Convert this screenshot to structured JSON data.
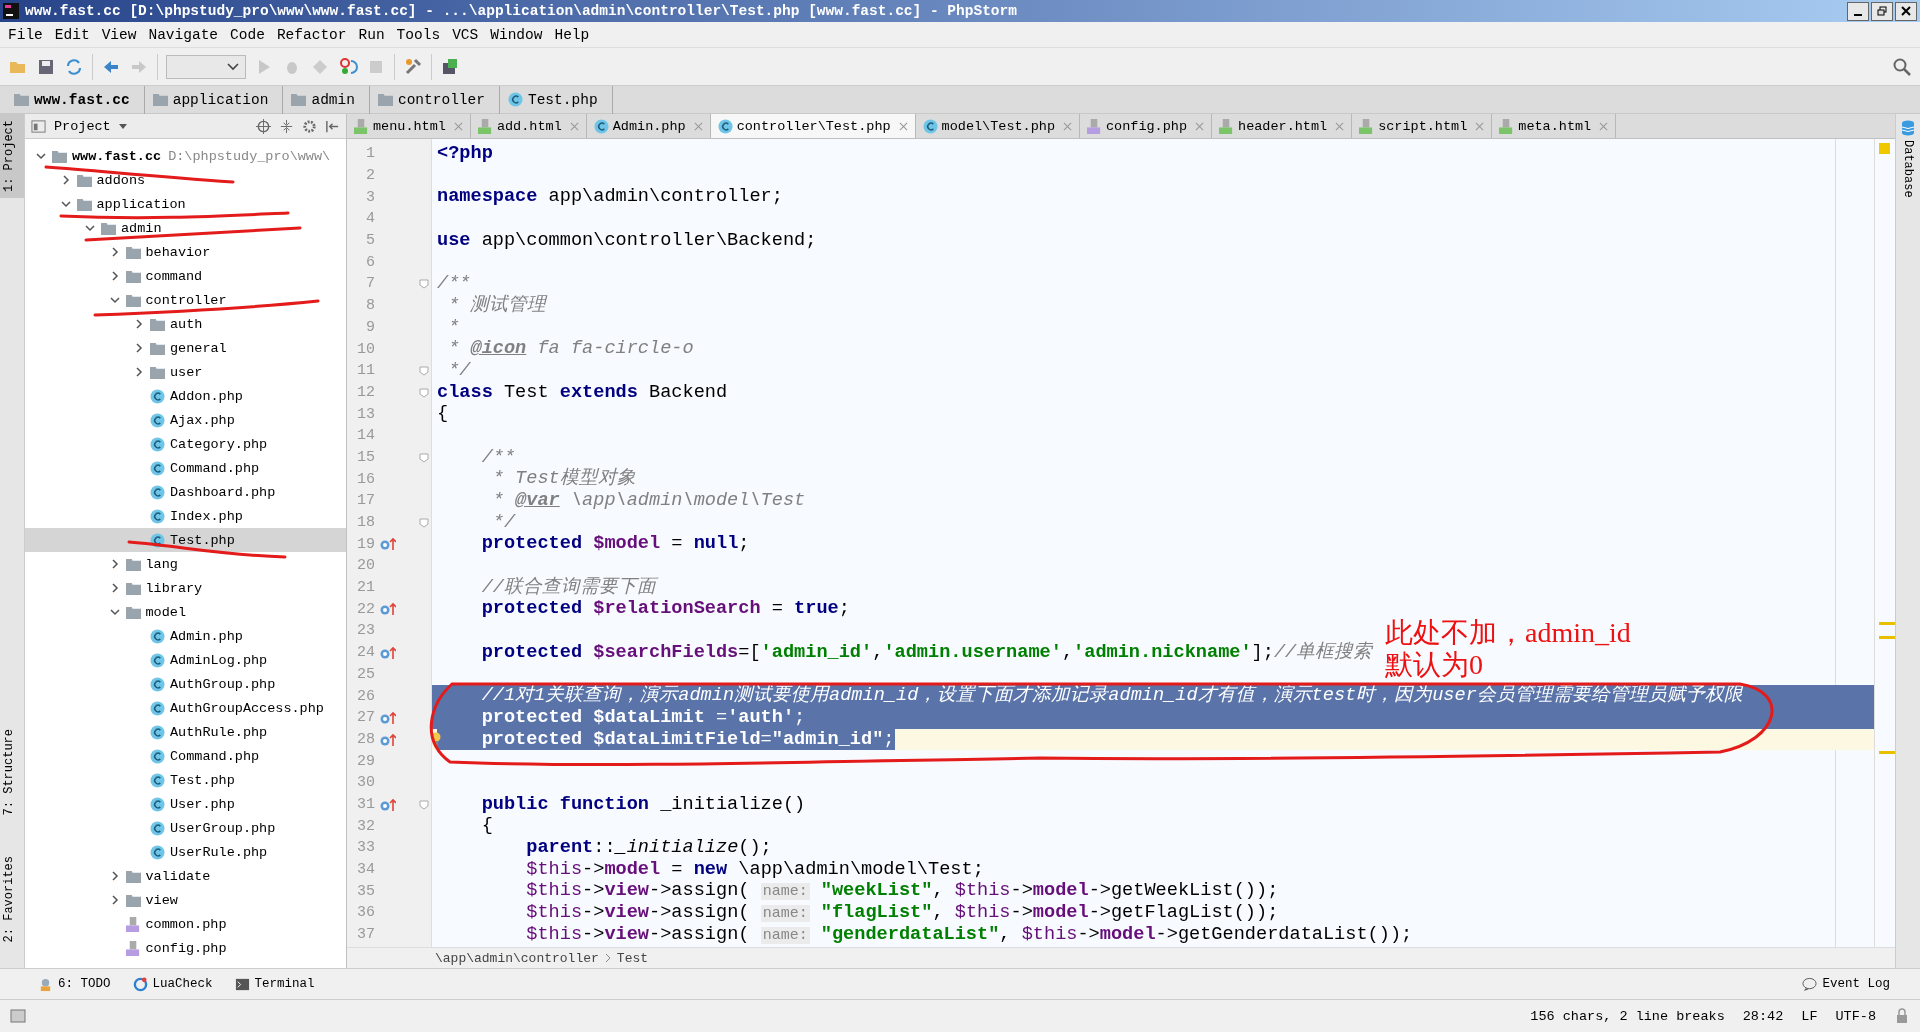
{
  "window": {
    "title": "www.fast.cc [D:\\phpstudy_pro\\www\\www.fast.cc] - ...\\application\\admin\\controller\\Test.php [www.fast.cc] - PhpStorm"
  },
  "menu": [
    "File",
    "Edit",
    "View",
    "Navigate",
    "Code",
    "Refactor",
    "Run",
    "Tools",
    "VCS",
    "Window",
    "Help"
  ],
  "nav_bar": [
    {
      "label": "www.fast.cc",
      "kind": "root"
    },
    {
      "label": "application",
      "kind": "folder"
    },
    {
      "label": "admin",
      "kind": "folder"
    },
    {
      "label": "controller",
      "kind": "folder"
    },
    {
      "label": "Test.php",
      "kind": "class"
    }
  ],
  "left_stripe": [
    {
      "label": "1: Project",
      "selected": true
    },
    {
      "label": "7: Structure",
      "selected": false
    },
    {
      "label": "2: Favorites",
      "selected": false
    }
  ],
  "right_stripe": [
    {
      "label": "Database"
    }
  ],
  "project": {
    "title": "Project",
    "tree": [
      {
        "label": "www.fast.cc",
        "path": "D:\\phpstudy_pro\\www\\",
        "kind": "root",
        "expanded": true,
        "selected": false,
        "children": [
          {
            "label": "addons",
            "kind": "folder",
            "expanded": false,
            "selected": false
          },
          {
            "label": "application",
            "kind": "folder",
            "expanded": true,
            "selected": false,
            "children": [
              {
                "label": "admin",
                "kind": "folder",
                "expanded": true,
                "selected": false,
                "children": [
                  {
                    "label": "behavior",
                    "kind": "folder",
                    "expanded": false,
                    "selected": false
                  },
                  {
                    "label": "command",
                    "kind": "folder",
                    "expanded": false,
                    "selected": false
                  },
                  {
                    "label": "controller",
                    "kind": "folder",
                    "expanded": true,
                    "selected": false,
                    "children": [
                      {
                        "label": "auth",
                        "kind": "folder",
                        "expanded": false,
                        "selected": false
                      },
                      {
                        "label": "general",
                        "kind": "folder",
                        "expanded": false,
                        "selected": false
                      },
                      {
                        "label": "user",
                        "kind": "folder",
                        "expanded": false,
                        "selected": false
                      },
                      {
                        "label": "Addon.php",
                        "kind": "class",
                        "selected": false
                      },
                      {
                        "label": "Ajax.php",
                        "kind": "class",
                        "selected": false
                      },
                      {
                        "label": "Category.php",
                        "kind": "class",
                        "selected": false
                      },
                      {
                        "label": "Command.php",
                        "kind": "class",
                        "selected": false
                      },
                      {
                        "label": "Dashboard.php",
                        "kind": "class",
                        "selected": false
                      },
                      {
                        "label": "Index.php",
                        "kind": "class",
                        "selected": false
                      },
                      {
                        "label": "Test.php",
                        "kind": "class",
                        "selected": true
                      }
                    ]
                  },
                  {
                    "label": "lang",
                    "kind": "folder",
                    "expanded": false,
                    "selected": false
                  },
                  {
                    "label": "library",
                    "kind": "folder",
                    "expanded": false,
                    "selected": false
                  },
                  {
                    "label": "model",
                    "kind": "folder",
                    "expanded": true,
                    "selected": false,
                    "children": [
                      {
                        "label": "Admin.php",
                        "kind": "class",
                        "selected": false
                      },
                      {
                        "label": "AdminLog.php",
                        "kind": "class",
                        "selected": false
                      },
                      {
                        "label": "AuthGroup.php",
                        "kind": "class",
                        "selected": false
                      },
                      {
                        "label": "AuthGroupAccess.php",
                        "kind": "class",
                        "selected": false
                      },
                      {
                        "label": "AuthRule.php",
                        "kind": "class",
                        "selected": false
                      },
                      {
                        "label": "Command.php",
                        "kind": "class",
                        "selected": false
                      },
                      {
                        "label": "Test.php",
                        "kind": "class",
                        "selected": false
                      },
                      {
                        "label": "User.php",
                        "kind": "class",
                        "selected": false
                      },
                      {
                        "label": "UserGroup.php",
                        "kind": "class",
                        "selected": false
                      },
                      {
                        "label": "UserRule.php",
                        "kind": "class",
                        "selected": false
                      }
                    ]
                  },
                  {
                    "label": "validate",
                    "kind": "folder",
                    "expanded": false,
                    "selected": false
                  },
                  {
                    "label": "view",
                    "kind": "folder",
                    "expanded": false,
                    "selected": false
                  },
                  {
                    "label": "common.php",
                    "kind": "php",
                    "selected": false
                  },
                  {
                    "label": "config.php",
                    "kind": "php",
                    "selected": false
                  }
                ]
              }
            ]
          }
        ]
      }
    ]
  },
  "tabs": [
    {
      "label": "menu.html",
      "kind": "html",
      "selected": false
    },
    {
      "label": "add.html",
      "kind": "html",
      "selected": false
    },
    {
      "label": "Admin.php",
      "kind": "class",
      "selected": false
    },
    {
      "label": "controller\\Test.php",
      "kind": "class",
      "selected": true
    },
    {
      "label": "model\\Test.php",
      "kind": "class",
      "selected": false
    },
    {
      "label": "config.php",
      "kind": "php",
      "selected": false
    },
    {
      "label": "header.html",
      "kind": "html",
      "selected": false
    },
    {
      "label": "script.html",
      "kind": "html",
      "selected": false
    },
    {
      "label": "meta.html",
      "kind": "html",
      "selected": false
    }
  ],
  "code": [
    {
      "n": "1",
      "selected": false,
      "segs": [
        {
          "kind": "k",
          "text": "<?php"
        }
      ]
    },
    {
      "n": "2",
      "selected": false
    },
    {
      "n": "3",
      "selected": false,
      "segs": [
        {
          "kind": "k",
          "text": "namespace"
        },
        {
          "kind": "t",
          "text": " app\\admin\\controller;"
        }
      ]
    },
    {
      "n": "4",
      "selected": false
    },
    {
      "n": "5",
      "selected": false,
      "segs": [
        {
          "kind": "k",
          "text": "use"
        },
        {
          "kind": "t",
          "text": " app\\common\\controller\\Backend;"
        }
      ]
    },
    {
      "n": "6",
      "selected": false
    },
    {
      "n": "7",
      "selected": false,
      "fold": true,
      "segs": [
        {
          "kind": "c",
          "text": "/**"
        }
      ]
    },
    {
      "n": "8",
      "selected": false,
      "segs": [
        {
          "kind": "c",
          "text": " * 测试管理"
        }
      ]
    },
    {
      "n": "9",
      "selected": false,
      "segs": [
        {
          "kind": "c",
          "text": " *"
        }
      ]
    },
    {
      "n": "10",
      "selected": false,
      "segs": [
        {
          "kind": "c",
          "text": " * "
        },
        {
          "kind": "d",
          "text": "@icon"
        },
        {
          "kind": "c",
          "text": " fa fa-circle-o"
        }
      ]
    },
    {
      "n": "11",
      "selected": false,
      "fold": true,
      "segs": [
        {
          "kind": "c",
          "text": " */"
        }
      ]
    },
    {
      "n": "12",
      "selected": false,
      "fold": true,
      "segs": [
        {
          "kind": "k",
          "text": "class"
        },
        {
          "kind": "t",
          "text": " Test "
        },
        {
          "kind": "k",
          "text": "extends"
        },
        {
          "kind": "t",
          "text": " Backend"
        }
      ]
    },
    {
      "n": "13",
      "selected": false,
      "segs": [
        {
          "kind": "t",
          "text": "{"
        }
      ]
    },
    {
      "n": "14",
      "selected": false
    },
    {
      "n": "15",
      "selected": false,
      "fold": true,
      "segs": [
        {
          "kind": "c",
          "text": "    /**"
        }
      ]
    },
    {
      "n": "16",
      "selected": false,
      "segs": [
        {
          "kind": "c",
          "text": "     * Test模型对象"
        }
      ]
    },
    {
      "n": "17",
      "selected": false,
      "segs": [
        {
          "kind": "c",
          "text": "     * "
        },
        {
          "kind": "d",
          "text": "@var"
        },
        {
          "kind": "c",
          "text": " \\app\\admin\\model\\Test"
        }
      ]
    },
    {
      "n": "18",
      "selected": false,
      "fold": true,
      "segs": [
        {
          "kind": "c",
          "text": "     */"
        }
      ]
    },
    {
      "n": "19",
      "selected": false,
      "override": true,
      "segs": [
        {
          "kind": "k",
          "text": "    protected "
        },
        {
          "kind": "v",
          "text": "$model"
        },
        {
          "kind": "t",
          "text": " = "
        },
        {
          "kind": "k",
          "text": "null"
        },
        {
          "kind": "t",
          "text": ";"
        }
      ]
    },
    {
      "n": "20",
      "selected": false
    },
    {
      "n": "21",
      "selected": false,
      "segs": [
        {
          "kind": "c",
          "text": "    //联合查询需要下面"
        }
      ]
    },
    {
      "n": "22",
      "selected": false,
      "override": true,
      "segs": [
        {
          "kind": "k",
          "text": "    protected "
        },
        {
          "kind": "v",
          "text": "$relationSearch"
        },
        {
          "kind": "t",
          "text": " = "
        },
        {
          "kind": "k",
          "text": "true"
        },
        {
          "kind": "t",
          "text": ";"
        }
      ]
    },
    {
      "n": "23",
      "selected": false
    },
    {
      "n": "24",
      "selected": false,
      "override": true,
      "segs": [
        {
          "kind": "k",
          "text": "    protected "
        },
        {
          "kind": "v",
          "text": "$searchFields"
        },
        {
          "kind": "t",
          "text": "=["
        },
        {
          "kind": "s",
          "text": "'admin_id'"
        },
        {
          "kind": "t",
          "text": ","
        },
        {
          "kind": "s",
          "text": "'admin.username'"
        },
        {
          "kind": "t",
          "text": ","
        },
        {
          "kind": "s",
          "text": "'admin.nickname'"
        },
        {
          "kind": "t",
          "text": "];"
        },
        {
          "kind": "c",
          "text": "//单框搜索"
        }
      ]
    },
    {
      "n": "25",
      "selected": false
    },
    {
      "n": "26",
      "selected": true,
      "segs": [
        {
          "kind": "c",
          "text": "    //1对1关联查询，演示admin测试要使用admin_id，设置下面才添加记录admin_id才有值，演示test时，因为user会员管理需要给管理员赋予权限"
        }
      ]
    },
    {
      "n": "27",
      "selected": true,
      "override": true,
      "segs": [
        {
          "kind": "k",
          "text": "    protected "
        },
        {
          "kind": "v",
          "text": "$dataLimit"
        },
        {
          "kind": "t",
          "text": " ="
        },
        {
          "kind": "s",
          "text": "'auth'"
        },
        {
          "kind": "t",
          "text": ";"
        }
      ]
    },
    {
      "n": "28",
      "selected": true,
      "current": true,
      "override": true,
      "bulb": true,
      "segs": [
        {
          "kind": "k",
          "text": "    protected "
        },
        {
          "kind": "v",
          "text": "$dataLimitField"
        },
        {
          "kind": "t",
          "text": "="
        },
        {
          "kind": "s",
          "text": "\"admin_id\""
        },
        {
          "kind": "t",
          "text": ";"
        }
      ]
    },
    {
      "n": "29",
      "selected": false
    },
    {
      "n": "30",
      "selected": false
    },
    {
      "n": "31",
      "selected": false,
      "override": true,
      "fold": true,
      "segs": [
        {
          "kind": "k",
          "text": "    public function"
        },
        {
          "kind": "t",
          "text": " _initialize()"
        }
      ]
    },
    {
      "n": "32",
      "selected": false,
      "segs": [
        {
          "kind": "t",
          "text": "    {"
        }
      ]
    },
    {
      "n": "33",
      "selected": false,
      "segs": [
        {
          "kind": "k",
          "text": "        parent"
        },
        {
          "kind": "t",
          "text": "::"
        },
        {
          "kind": "i",
          "text": "_initialize"
        },
        {
          "kind": "t",
          "text": "();"
        }
      ]
    },
    {
      "n": "34",
      "selected": false,
      "segs": [
        {
          "kind": "p",
          "text": "        $this"
        },
        {
          "kind": "t",
          "text": "->"
        },
        {
          "kind": "v",
          "text": "model"
        },
        {
          "kind": "t",
          "text": " = "
        },
        {
          "kind": "k",
          "text": "new"
        },
        {
          "kind": "t",
          "text": " \\app\\admin\\model\\Test;"
        }
      ]
    },
    {
      "n": "35",
      "selected": false,
      "segs": [
        {
          "kind": "p",
          "text": "        $this"
        },
        {
          "kind": "t",
          "text": "->"
        },
        {
          "kind": "v",
          "text": "view"
        },
        {
          "kind": "t",
          "text": "->assign( "
        },
        {
          "kind": "h",
          "text": "name:"
        },
        {
          "kind": "s",
          "text": " \"weekList\""
        },
        {
          "kind": "t",
          "text": ", "
        },
        {
          "kind": "p",
          "text": "$this"
        },
        {
          "kind": "t",
          "text": "->"
        },
        {
          "kind": "v",
          "text": "model"
        },
        {
          "kind": "t",
          "text": "->getWeekList());"
        }
      ]
    },
    {
      "n": "36",
      "selected": false,
      "segs": [
        {
          "kind": "p",
          "text": "        $this"
        },
        {
          "kind": "t",
          "text": "->"
        },
        {
          "kind": "v",
          "text": "view"
        },
        {
          "kind": "t",
          "text": "->assign( "
        },
        {
          "kind": "h",
          "text": "name:"
        },
        {
          "kind": "s",
          "text": " \"flagList\""
        },
        {
          "kind": "t",
          "text": ", "
        },
        {
          "kind": "p",
          "text": "$this"
        },
        {
          "kind": "t",
          "text": "->"
        },
        {
          "kind": "v",
          "text": "model"
        },
        {
          "kind": "t",
          "text": "->getFlagList());"
        }
      ]
    },
    {
      "n": "37",
      "selected": false,
      "segs": [
        {
          "kind": "p",
          "text": "        $this"
        },
        {
          "kind": "t",
          "text": "->"
        },
        {
          "kind": "v",
          "text": "view"
        },
        {
          "kind": "t",
          "text": "->assign( "
        },
        {
          "kind": "h",
          "text": "name:"
        },
        {
          "kind": "s",
          "text": " \"genderdataList\""
        },
        {
          "kind": "t",
          "text": ", "
        },
        {
          "kind": "p",
          "text": "$this"
        },
        {
          "kind": "t",
          "text": "->"
        },
        {
          "kind": "v",
          "text": "model"
        },
        {
          "kind": "t",
          "text": "->getGenderdataList());"
        }
      ]
    }
  ],
  "editor_breadcrumb": [
    "\\app\\admin\\controller",
    "Test"
  ],
  "annotation": [
    "此处不加，admin_id",
    "默认为0"
  ],
  "tool_windows": [
    {
      "label": "6: TODO",
      "kind": "todo"
    },
    {
      "label": "LuaCheck",
      "kind": "lua"
    },
    {
      "label": "Terminal",
      "kind": "terminal"
    }
  ],
  "event_log": "Event Log",
  "status_bar": {
    "info": "156 chars, 2 line breaks",
    "position": "28:42",
    "line_sep": "LF",
    "encoding": "UTF-8"
  }
}
